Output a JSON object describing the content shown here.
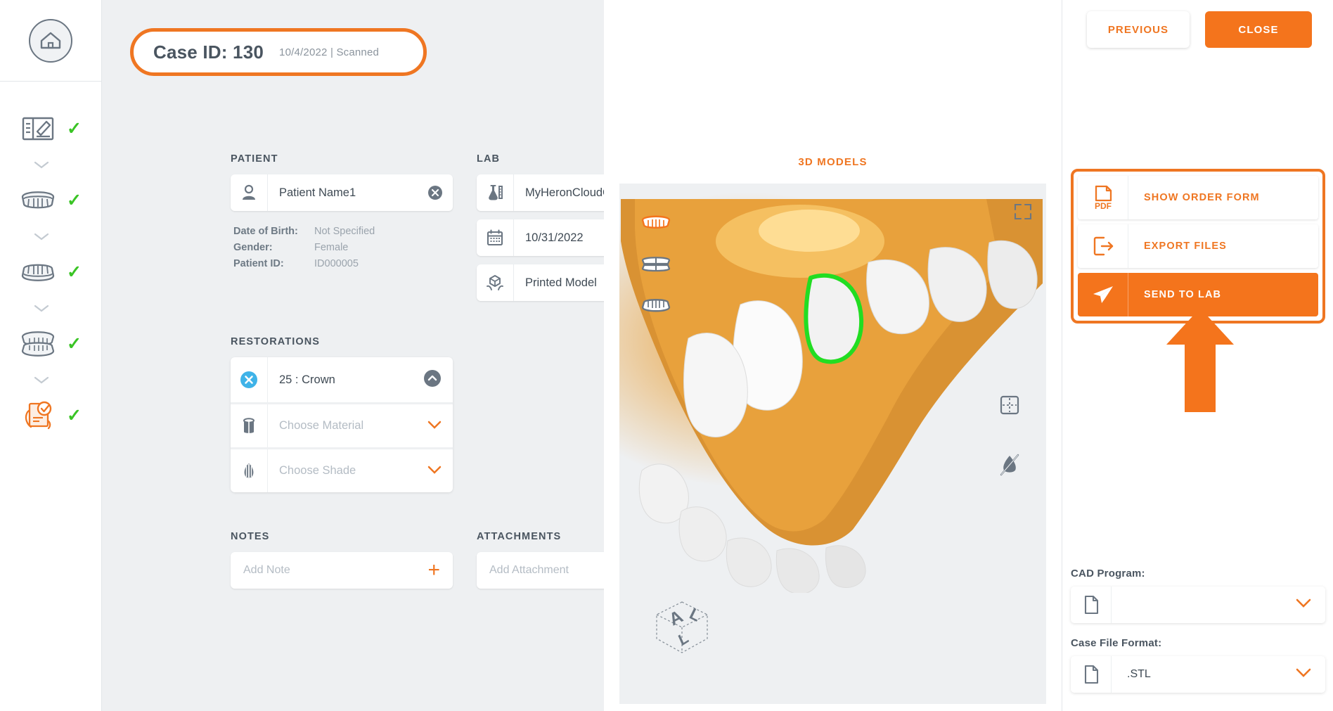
{
  "case": {
    "title": "Case ID: 130",
    "date": "10/4/2022",
    "separator": "|",
    "status": "Scanned"
  },
  "sidebar": {
    "home_icon": "home-icon",
    "steps": [
      {
        "icon": "order-form-icon",
        "check": "✓"
      },
      {
        "icon": "upper-arch-icon",
        "check": "✓"
      },
      {
        "icon": "lower-arch-icon",
        "check": "✓"
      },
      {
        "icon": "bite-occlusion-icon",
        "check": "✓"
      },
      {
        "icon": "prescription-icon",
        "check": "✓"
      }
    ]
  },
  "patient": {
    "section_label": "PATIENT",
    "name": "Patient Name1",
    "name_icon": "person-icon",
    "clear_icon": "clear-circle-icon",
    "details": [
      {
        "key": "Date of Birth:",
        "value": "Not Specified"
      },
      {
        "key": "Gender:",
        "value": "Female"
      },
      {
        "key": "Patient ID:",
        "value": "ID000005"
      }
    ]
  },
  "lab": {
    "section_label": "LAB",
    "connection": "MyHeronCloudConnection",
    "connection_icon": "flask-icon",
    "due_date": "10/31/2022",
    "date_icon": "calendar-icon",
    "printed_model": "Printed Model",
    "model_icon": "printed-model-icon",
    "printed_model_checked": true
  },
  "restorations": {
    "section_label": "RESTORATIONS",
    "tooth": "25 : Crown",
    "tooth_icon": "remove-circle-icon",
    "collapse_icon": "chevron-up-circle-icon",
    "material_placeholder": "Choose Material",
    "material_icon": "material-cylinder-icon",
    "shade_placeholder": "Choose Shade",
    "shade_icon": "shade-icon"
  },
  "notes": {
    "section_label": "NOTES",
    "placeholder": "Add Note",
    "add_icon": "plus-icon"
  },
  "attachments": {
    "section_label": "ATTACHMENTS",
    "placeholder": "Add Attachment",
    "add_icon": "plus-icon"
  },
  "viewer": {
    "title": "3D MODELS",
    "layer_toggles": [
      "upper-arch-toggle",
      "bite-toggle",
      "lower-arch-toggle"
    ],
    "fullscreen_icon": "expand-icon",
    "grid_icon": "sectioning-grid-icon",
    "hide_tissue_icon": "hide-gingiva-icon",
    "orientation_cube": {
      "face_top": "A",
      "face_right": "L",
      "face_front": "L"
    }
  },
  "top_actions": {
    "previous": "PREVIOUS",
    "close": "CLOSE"
  },
  "actions": [
    {
      "label": "SHOW ORDER FORM",
      "icon": "pdf-file-icon",
      "primary": false
    },
    {
      "label": "EXPORT FILES",
      "icon": "export-icon",
      "primary": false
    },
    {
      "label": "SEND TO LAB",
      "icon": "send-paper-plane-icon",
      "primary": true
    }
  ],
  "export_settings": {
    "cad_label": "CAD Program:",
    "cad_value": "",
    "cad_icon": "file-icon",
    "format_label": "Case File Format:",
    "format_value": ".STL",
    "format_icon": "file-icon"
  },
  "colors": {
    "accent": "#ef7622",
    "accent_solid": "#f4741c",
    "check_green": "#3ac425",
    "margin_green": "#22dd22",
    "panel_bg": "#eef0f2",
    "text_dark": "#4a5560",
    "text_muted": "#9aa3ac",
    "tooth_blue": "#3fb3e8",
    "gingiva": "#e8a13c"
  }
}
